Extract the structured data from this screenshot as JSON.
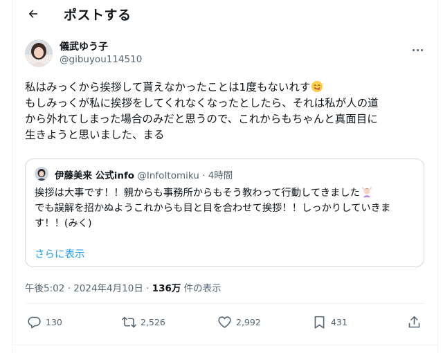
{
  "header": {
    "title": "ポストする"
  },
  "post": {
    "author_name": "儀武ゆう子",
    "author_handle": "@gibuyou114510",
    "lines": [
      "私はみっくから挨拶して貰えなかったことは1度もないれす",
      "もしみっくが私に挨拶をしてくれなくなったとしたら、それは私が人の道",
      "から外れてしまった場合のみだと思うので、これからもちゃんと真面目に",
      "生きようと思いました、まる"
    ]
  },
  "quote": {
    "author_name": "伊藤美来 公式info",
    "author_handle": "@InfoItomiku",
    "time": "· 4時間",
    "lines": [
      "挨拶は大事です！！親からも事務所からもそう教わって行動してきました",
      "",
      "でも誤解を招かぬようこれからも目と目を合わせて挨拶！！しっかりしていきま",
      "す！！(みく)"
    ],
    "show_more": "さらに表示"
  },
  "meta": {
    "timestamp": "午後5:02 · 2024年4月10日 · ",
    "views_count": "136万",
    "views_label": " 件の表示"
  },
  "actions": {
    "replies": "130",
    "reposts": "2,526",
    "likes": "2,992",
    "bookmarks": "431"
  },
  "icons": {
    "back": "arrow-left-icon",
    "more": "more-horizontal-icon",
    "reply": "speech-bubble-icon",
    "repost": "repost-arrows-icon",
    "like": "heart-icon",
    "bookmark": "bookmark-icon",
    "share": "share-upload-icon"
  }
}
